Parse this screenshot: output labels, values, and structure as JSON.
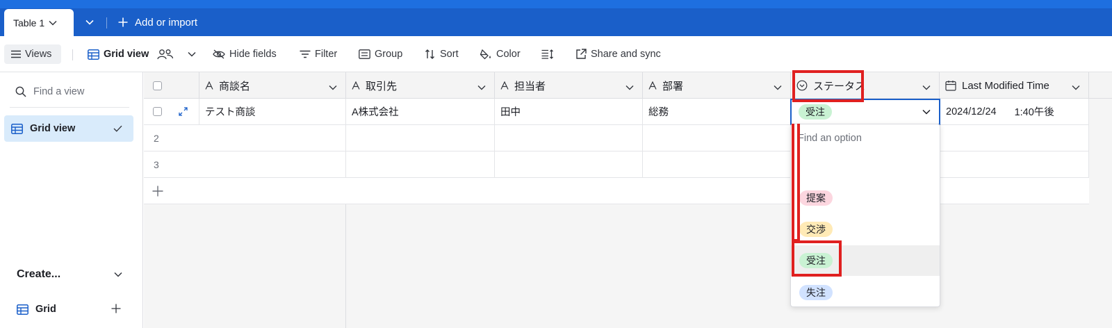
{
  "tabs": {
    "active": "Table 1",
    "add_import": "Add or import"
  },
  "toolbar": {
    "views": "Views",
    "grid_view": "Grid view",
    "hide_fields": "Hide fields",
    "filter": "Filter",
    "group": "Group",
    "sort": "Sort",
    "color": "Color",
    "share_sync": "Share and sync"
  },
  "sidebar": {
    "find_placeholder": "Find a view",
    "views": [
      {
        "label": "Grid view",
        "selected": true
      }
    ],
    "create_label": "Create...",
    "create_items": [
      {
        "label": "Grid"
      }
    ]
  },
  "grid": {
    "columns": [
      {
        "label": "商談名",
        "type": "text"
      },
      {
        "label": "取引先",
        "type": "text"
      },
      {
        "label": "担当者",
        "type": "text"
      },
      {
        "label": "部署",
        "type": "text"
      },
      {
        "label": "ステータス",
        "type": "single-select"
      },
      {
        "label": "Last Modified Time",
        "type": "date"
      }
    ],
    "rows": [
      {
        "num": "1",
        "商談名": "テスト商談",
        "取引先": "A株式会社",
        "担当者": "田中",
        "部署": "総務",
        "ステータス": "受注",
        "date": "2024/12/24",
        "time": "1:40午後"
      },
      {
        "num": "2"
      },
      {
        "num": "3"
      }
    ]
  },
  "status_dropdown": {
    "search_placeholder": "Find an option",
    "options": [
      {
        "label": "提案",
        "color": "#fcd6df"
      },
      {
        "label": "交渉",
        "color": "#ffeab6"
      },
      {
        "label": "受注",
        "color": "#c9f2d3",
        "selected": true
      },
      {
        "label": "失注",
        "color": "#d1e2ff"
      }
    ]
  },
  "colors": {
    "header_blue": "#1a5fc9",
    "highlight_red": "#e02020",
    "selected_view_bg": "#d9ebfb"
  }
}
